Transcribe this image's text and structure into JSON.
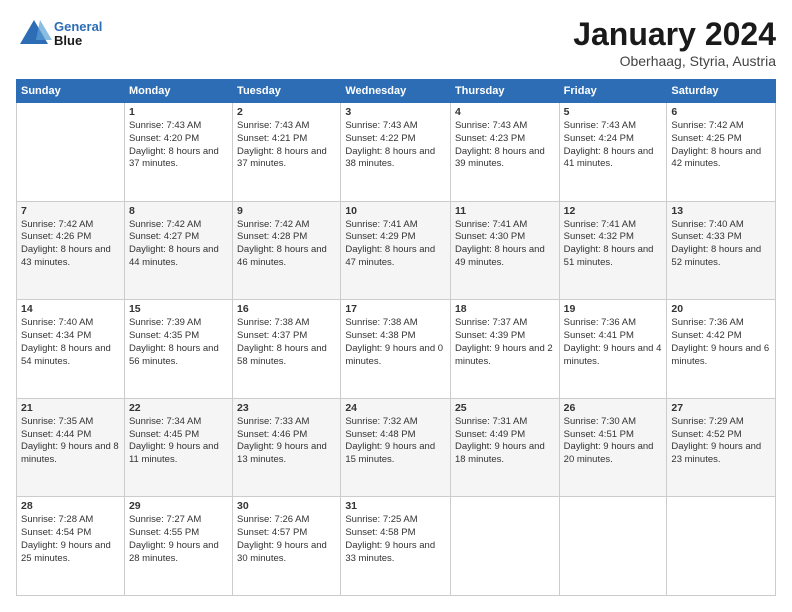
{
  "logo": {
    "line1": "General",
    "line2": "Blue"
  },
  "title": "January 2024",
  "subtitle": "Oberhaag, Styria, Austria",
  "days_header": [
    "Sunday",
    "Monday",
    "Tuesday",
    "Wednesday",
    "Thursday",
    "Friday",
    "Saturday"
  ],
  "weeks": [
    [
      {
        "day": "",
        "sunrise": "",
        "sunset": "",
        "daylight": ""
      },
      {
        "day": "1",
        "sunrise": "Sunrise: 7:43 AM",
        "sunset": "Sunset: 4:20 PM",
        "daylight": "Daylight: 8 hours and 37 minutes."
      },
      {
        "day": "2",
        "sunrise": "Sunrise: 7:43 AM",
        "sunset": "Sunset: 4:21 PM",
        "daylight": "Daylight: 8 hours and 37 minutes."
      },
      {
        "day": "3",
        "sunrise": "Sunrise: 7:43 AM",
        "sunset": "Sunset: 4:22 PM",
        "daylight": "Daylight: 8 hours and 38 minutes."
      },
      {
        "day": "4",
        "sunrise": "Sunrise: 7:43 AM",
        "sunset": "Sunset: 4:23 PM",
        "daylight": "Daylight: 8 hours and 39 minutes."
      },
      {
        "day": "5",
        "sunrise": "Sunrise: 7:43 AM",
        "sunset": "Sunset: 4:24 PM",
        "daylight": "Daylight: 8 hours and 41 minutes."
      },
      {
        "day": "6",
        "sunrise": "Sunrise: 7:42 AM",
        "sunset": "Sunset: 4:25 PM",
        "daylight": "Daylight: 8 hours and 42 minutes."
      }
    ],
    [
      {
        "day": "7",
        "sunrise": "Sunrise: 7:42 AM",
        "sunset": "Sunset: 4:26 PM",
        "daylight": "Daylight: 8 hours and 43 minutes."
      },
      {
        "day": "8",
        "sunrise": "Sunrise: 7:42 AM",
        "sunset": "Sunset: 4:27 PM",
        "daylight": "Daylight: 8 hours and 44 minutes."
      },
      {
        "day": "9",
        "sunrise": "Sunrise: 7:42 AM",
        "sunset": "Sunset: 4:28 PM",
        "daylight": "Daylight: 8 hours and 46 minutes."
      },
      {
        "day": "10",
        "sunrise": "Sunrise: 7:41 AM",
        "sunset": "Sunset: 4:29 PM",
        "daylight": "Daylight: 8 hours and 47 minutes."
      },
      {
        "day": "11",
        "sunrise": "Sunrise: 7:41 AM",
        "sunset": "Sunset: 4:30 PM",
        "daylight": "Daylight: 8 hours and 49 minutes."
      },
      {
        "day": "12",
        "sunrise": "Sunrise: 7:41 AM",
        "sunset": "Sunset: 4:32 PM",
        "daylight": "Daylight: 8 hours and 51 minutes."
      },
      {
        "day": "13",
        "sunrise": "Sunrise: 7:40 AM",
        "sunset": "Sunset: 4:33 PM",
        "daylight": "Daylight: 8 hours and 52 minutes."
      }
    ],
    [
      {
        "day": "14",
        "sunrise": "Sunrise: 7:40 AM",
        "sunset": "Sunset: 4:34 PM",
        "daylight": "Daylight: 8 hours and 54 minutes."
      },
      {
        "day": "15",
        "sunrise": "Sunrise: 7:39 AM",
        "sunset": "Sunset: 4:35 PM",
        "daylight": "Daylight: 8 hours and 56 minutes."
      },
      {
        "day": "16",
        "sunrise": "Sunrise: 7:38 AM",
        "sunset": "Sunset: 4:37 PM",
        "daylight": "Daylight: 8 hours and 58 minutes."
      },
      {
        "day": "17",
        "sunrise": "Sunrise: 7:38 AM",
        "sunset": "Sunset: 4:38 PM",
        "daylight": "Daylight: 9 hours and 0 minutes."
      },
      {
        "day": "18",
        "sunrise": "Sunrise: 7:37 AM",
        "sunset": "Sunset: 4:39 PM",
        "daylight": "Daylight: 9 hours and 2 minutes."
      },
      {
        "day": "19",
        "sunrise": "Sunrise: 7:36 AM",
        "sunset": "Sunset: 4:41 PM",
        "daylight": "Daylight: 9 hours and 4 minutes."
      },
      {
        "day": "20",
        "sunrise": "Sunrise: 7:36 AM",
        "sunset": "Sunset: 4:42 PM",
        "daylight": "Daylight: 9 hours and 6 minutes."
      }
    ],
    [
      {
        "day": "21",
        "sunrise": "Sunrise: 7:35 AM",
        "sunset": "Sunset: 4:44 PM",
        "daylight": "Daylight: 9 hours and 8 minutes."
      },
      {
        "day": "22",
        "sunrise": "Sunrise: 7:34 AM",
        "sunset": "Sunset: 4:45 PM",
        "daylight": "Daylight: 9 hours and 11 minutes."
      },
      {
        "day": "23",
        "sunrise": "Sunrise: 7:33 AM",
        "sunset": "Sunset: 4:46 PM",
        "daylight": "Daylight: 9 hours and 13 minutes."
      },
      {
        "day": "24",
        "sunrise": "Sunrise: 7:32 AM",
        "sunset": "Sunset: 4:48 PM",
        "daylight": "Daylight: 9 hours and 15 minutes."
      },
      {
        "day": "25",
        "sunrise": "Sunrise: 7:31 AM",
        "sunset": "Sunset: 4:49 PM",
        "daylight": "Daylight: 9 hours and 18 minutes."
      },
      {
        "day": "26",
        "sunrise": "Sunrise: 7:30 AM",
        "sunset": "Sunset: 4:51 PM",
        "daylight": "Daylight: 9 hours and 20 minutes."
      },
      {
        "day": "27",
        "sunrise": "Sunrise: 7:29 AM",
        "sunset": "Sunset: 4:52 PM",
        "daylight": "Daylight: 9 hours and 23 minutes."
      }
    ],
    [
      {
        "day": "28",
        "sunrise": "Sunrise: 7:28 AM",
        "sunset": "Sunset: 4:54 PM",
        "daylight": "Daylight: 9 hours and 25 minutes."
      },
      {
        "day": "29",
        "sunrise": "Sunrise: 7:27 AM",
        "sunset": "Sunset: 4:55 PM",
        "daylight": "Daylight: 9 hours and 28 minutes."
      },
      {
        "day": "30",
        "sunrise": "Sunrise: 7:26 AM",
        "sunset": "Sunset: 4:57 PM",
        "daylight": "Daylight: 9 hours and 30 minutes."
      },
      {
        "day": "31",
        "sunrise": "Sunrise: 7:25 AM",
        "sunset": "Sunset: 4:58 PM",
        "daylight": "Daylight: 9 hours and 33 minutes."
      },
      {
        "day": "",
        "sunrise": "",
        "sunset": "",
        "daylight": ""
      },
      {
        "day": "",
        "sunrise": "",
        "sunset": "",
        "daylight": ""
      },
      {
        "day": "",
        "sunrise": "",
        "sunset": "",
        "daylight": ""
      }
    ]
  ]
}
